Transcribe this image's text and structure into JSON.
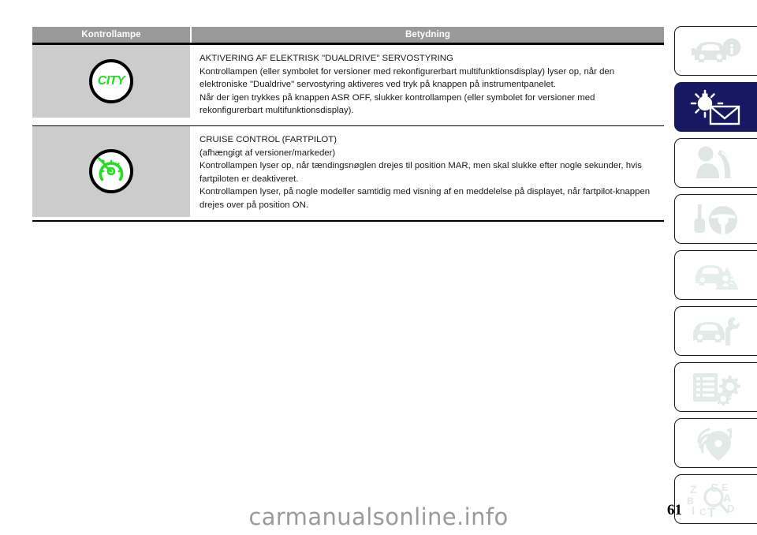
{
  "table": {
    "headers": {
      "col1": "Kontrollampe",
      "col2": "Betydning"
    },
    "rows": [
      {
        "icon_name": "city-telltale-icon",
        "icon_label": "CITY",
        "lines": [
          "AKTIVERING AF ELEKTRISK \"DUALDRIVE\" SERVOSTYRING",
          "Kontrollampen (eller symbolet for versioner med rekonfigurerbart multifunktionsdisplay) lyser op, når den elektroniske \"Dualdrive\" servostyring aktiveres ved tryk på knappen på instrumentpanelet.",
          "Når der igen trykkes på knappen ASR OFF, slukker kontrollampen (eller symbolet for versioner med rekonfigurerbart multifunktionsdisplay)."
        ]
      },
      {
        "icon_name": "cruise-control-telltale-icon",
        "icon_label": "",
        "lines": [
          "CRUISE CONTROL (FARTPILOT)",
          "(afhængigt af versioner/markeder)",
          "Kontrollampen lyser op, når tændingsnøglen drejes til position MAR, men skal slukke efter nogle sekunder, hvis fartpiloten er deaktiveret.",
          "Kontrollampen lyser, på nogle modeller samtidig med visning af en meddelelse på displayet, når fartpilot-knappen drejes over på position ON."
        ]
      }
    ]
  },
  "sidebar": {
    "items": [
      {
        "icon": "car-info-icon",
        "active": false
      },
      {
        "icon": "warning-light-message-icon",
        "active": true
      },
      {
        "icon": "airbag-safety-icon",
        "active": false
      },
      {
        "icon": "key-steering-wheel-icon",
        "active": false
      },
      {
        "icon": "emergency-warning-icon",
        "active": false
      },
      {
        "icon": "car-wrench-maintenance-icon",
        "active": false
      },
      {
        "icon": "specs-gears-icon",
        "active": false
      },
      {
        "icon": "multimedia-music-icon",
        "active": false
      },
      {
        "icon": "alphabetical-index-icon",
        "active": false
      }
    ],
    "index_letters": [
      "Z",
      "S",
      "E",
      "B",
      "A",
      "I",
      "C",
      "T",
      "D"
    ]
  },
  "footer": {
    "page_number": "61",
    "watermark": "carmanualsonline.info"
  },
  "colors": {
    "header_gray": "#999999",
    "cell_gray": "#cccccc",
    "active_navy": "#171763",
    "telltale_green": "#22dd22"
  }
}
